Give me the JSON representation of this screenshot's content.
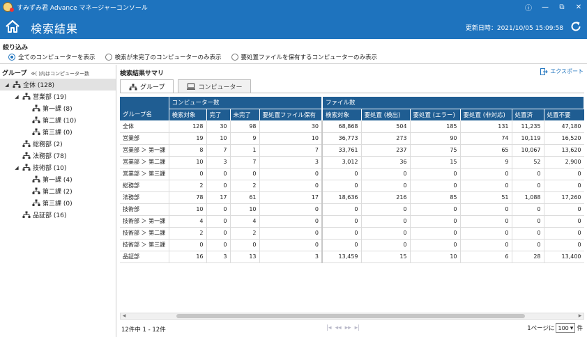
{
  "app": {
    "title": "すみずみ君 Advance マネージャーコンソール",
    "window_buttons": [
      "ⓘ",
      "—",
      "⧉",
      "✕"
    ]
  },
  "header": {
    "title": "検索結果",
    "updated": "更新日時：2021/10/05 15:09:58"
  },
  "filter": {
    "title": "絞り込み",
    "options": [
      "全てのコンピューターを表示",
      "検索が未完了のコンピューターのみ表示",
      "要処置ファイルを保有するコンピューターのみ表示"
    ],
    "selected": 0
  },
  "groups_panel": {
    "title": "グループ",
    "note": "※( )内はコンピューター数",
    "tree": [
      {
        "label": "全体 (128)",
        "level": 0,
        "toggle": "◢",
        "selected": true
      },
      {
        "label": "営業部 (19)",
        "level": 1,
        "toggle": "◢"
      },
      {
        "label": "第一課 (8)",
        "level": 2,
        "toggle": ""
      },
      {
        "label": "第二課 (10)",
        "level": 2,
        "toggle": ""
      },
      {
        "label": "第三課 (0)",
        "level": 2,
        "toggle": ""
      },
      {
        "label": "総務部 (2)",
        "level": 1,
        "toggle": ""
      },
      {
        "label": "法務部 (78)",
        "level": 1,
        "toggle": ""
      },
      {
        "label": "技術部 (10)",
        "level": 1,
        "toggle": "◢"
      },
      {
        "label": "第一課 (4)",
        "level": 2,
        "toggle": ""
      },
      {
        "label": "第二課 (2)",
        "level": 2,
        "toggle": ""
      },
      {
        "label": "第三課 (0)",
        "level": 2,
        "toggle": ""
      },
      {
        "label": "品証部 (16)",
        "level": 1,
        "toggle": ""
      }
    ]
  },
  "summary": {
    "title": "検索結果サマリ",
    "export_label": "エクスポート",
    "tabs": [
      "グループ",
      "コンピューター"
    ],
    "active_tab": 0
  },
  "table": {
    "group_col": "グループ名",
    "col_groups": [
      "コンピューター数",
      "ファイル数"
    ],
    "columns": [
      "検索対象",
      "完了",
      "未完了",
      "要処置ファイル保有",
      "検索対象",
      "要処置 (検出)",
      "要処置 (エラー)",
      "要処置 (非対応)",
      "処置済",
      "処置不要"
    ],
    "rows": [
      {
        "name": "全体",
        "v": [
          "128",
          "30",
          "98",
          "30",
          "68,868",
          "504",
          "185",
          "131",
          "11,235",
          "47,180"
        ]
      },
      {
        "name": "営業部",
        "v": [
          "19",
          "10",
          "9",
          "10",
          "36,773",
          "273",
          "90",
          "74",
          "10,119",
          "16,520"
        ]
      },
      {
        "name": "営業部 ＞ 第一課",
        "v": [
          "8",
          "7",
          "1",
          "7",
          "33,761",
          "237",
          "75",
          "65",
          "10,067",
          "13,620"
        ]
      },
      {
        "name": "営業部 ＞ 第二課",
        "v": [
          "10",
          "3",
          "7",
          "3",
          "3,012",
          "36",
          "15",
          "9",
          "52",
          "2,900"
        ]
      },
      {
        "name": "営業部 ＞ 第三課",
        "v": [
          "0",
          "0",
          "0",
          "0",
          "0",
          "0",
          "0",
          "0",
          "0",
          "0"
        ]
      },
      {
        "name": "総務部",
        "v": [
          "2",
          "0",
          "2",
          "0",
          "0",
          "0",
          "0",
          "0",
          "0",
          "0"
        ]
      },
      {
        "name": "法務部",
        "v": [
          "78",
          "17",
          "61",
          "17",
          "18,636",
          "216",
          "85",
          "51",
          "1,088",
          "17,260"
        ]
      },
      {
        "name": "技術部",
        "v": [
          "10",
          "0",
          "10",
          "0",
          "0",
          "0",
          "0",
          "0",
          "0",
          "0"
        ]
      },
      {
        "name": "技術部 ＞ 第一課",
        "v": [
          "4",
          "0",
          "4",
          "0",
          "0",
          "0",
          "0",
          "0",
          "0",
          "0"
        ]
      },
      {
        "name": "技術部 ＞ 第二課",
        "v": [
          "2",
          "0",
          "2",
          "0",
          "0",
          "0",
          "0",
          "0",
          "0",
          "0"
        ]
      },
      {
        "name": "技術部 ＞ 第三課",
        "v": [
          "0",
          "0",
          "0",
          "0",
          "0",
          "0",
          "0",
          "0",
          "0",
          "0"
        ]
      },
      {
        "name": "品証部",
        "v": [
          "16",
          "3",
          "13",
          "3",
          "13,459",
          "15",
          "10",
          "6",
          "28",
          "13,400"
        ]
      }
    ]
  },
  "footer": {
    "count": "12件中 1 - 12件",
    "per_page_prefix": "1ページに",
    "per_page": "100",
    "per_page_suffix": "件",
    "pager": [
      "|◂",
      "◂◂",
      "▸▸",
      "▸|"
    ]
  }
}
